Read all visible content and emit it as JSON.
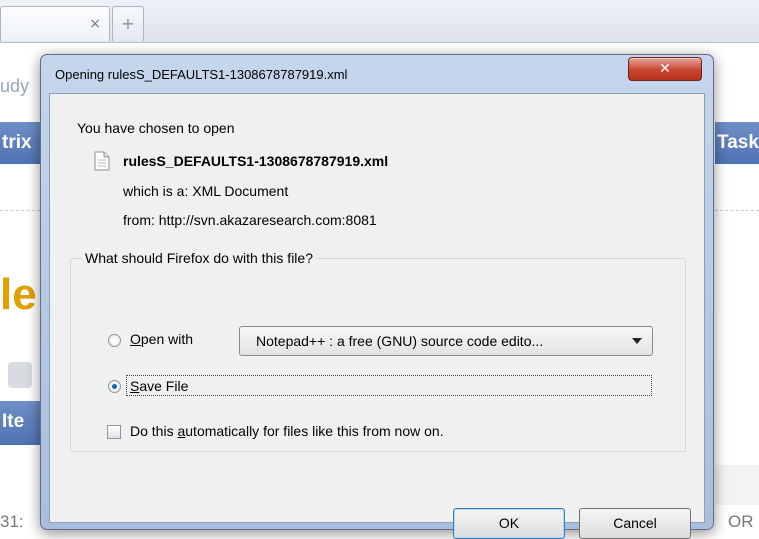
{
  "browser": {
    "tab_close_glyph": "×",
    "new_tab_glyph": "+",
    "bg_fragment_top": "udy",
    "bg_band_left": "trix",
    "bg_band_right": "Task",
    "bg_fragment_big": "le",
    "bg_band_left2": "Ite",
    "bg_fragment_bottom_left": "31:",
    "bg_fragment_bottom_right": "OR"
  },
  "dialog": {
    "title": "Opening rulesS_DEFAULTS1-1308678787919.xml",
    "close_glyph": "✕",
    "chosen_label": "You have chosen to open",
    "filename": "rulesS_DEFAULTS1-1308678787919.xml",
    "which_is_label": "which is a:",
    "which_is_value": "XML Document",
    "from_label": "from:",
    "from_value": "http://svn.akazaresearch.com:8081",
    "group_title": "What should Firefox do with this file?",
    "open_with": {
      "accel": "O",
      "rest": "pen with",
      "selected": false
    },
    "app_select_value": "Notepad++ : a free (GNU) source code edito...",
    "save_file": {
      "accel": "S",
      "rest": "ave File",
      "selected": true
    },
    "auto": {
      "before": "Do this ",
      "accel": "a",
      "after": "utomatically for files like this from now on.",
      "checked": false
    },
    "ok_label": "OK",
    "cancel_label": "Cancel"
  }
}
